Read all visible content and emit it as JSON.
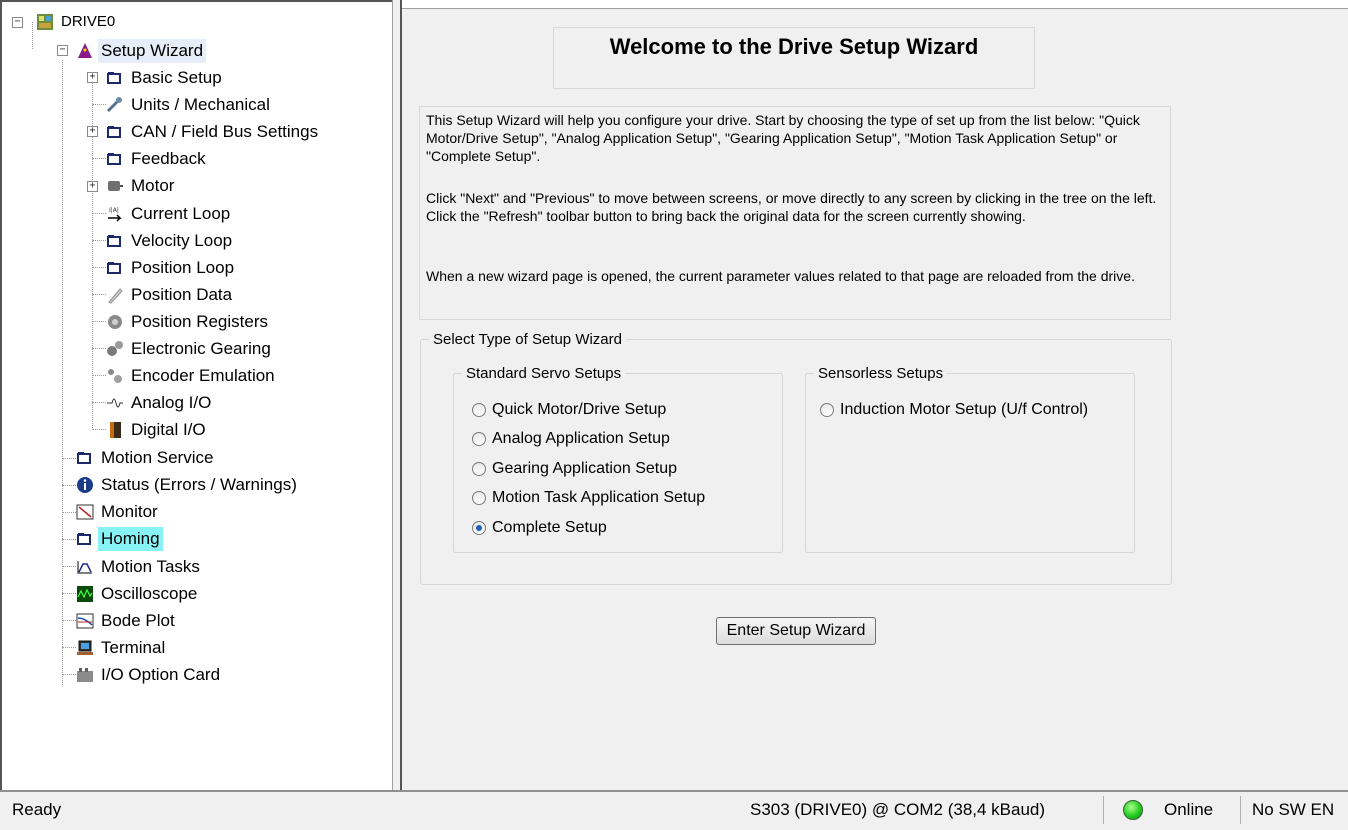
{
  "tree": {
    "root": "DRIVE0",
    "setup_wizard": "Setup Wizard",
    "basic_setup": "Basic Setup",
    "units": "Units / Mechanical",
    "can": "CAN / Field Bus Settings",
    "feedback": "Feedback",
    "motor": "Motor",
    "current_loop": "Current Loop",
    "velocity_loop": "Velocity Loop",
    "position_loop": "Position Loop",
    "position_data": "Position Data",
    "position_registers": "Position Registers",
    "electronic_gearing": "Electronic Gearing",
    "encoder_emulation": "Encoder Emulation",
    "analog_io": "Analog I/O",
    "digital_io": "Digital I/O",
    "motion_service": "Motion Service",
    "status": "Status (Errors / Warnings)",
    "monitor": "Monitor",
    "homing": "Homing",
    "motion_tasks": "Motion Tasks",
    "oscilloscope": "Oscilloscope",
    "bode_plot": "Bode Plot",
    "terminal": "Terminal",
    "io_option_card": "I/O Option Card"
  },
  "main": {
    "title": "Welcome to the Drive Setup Wizard",
    "intro_p1": "This Setup Wizard will help you configure your drive. Start by choosing the type of set up from the list below: \"Quick Motor/Drive Setup\", \"Analog Application Setup\", \"Gearing Application Setup\", \"Motion Task Application Setup\" or \"Complete Setup\".",
    "intro_p2": "Click \"Next\" and \"Previous\" to move between screens, or move directly to any screen by clicking in the tree on the left. Click the \"Refresh\" toolbar button to bring back the original data for the screen currently showing.",
    "intro_p3": "When a new wizard page is opened, the current parameter values related to that page are reloaded from the drive.",
    "select_group": "Select Type of Setup Wizard",
    "standard_group": "Standard Servo Setups",
    "sensorless_group": "Sensorless Setups",
    "standard_options": [
      "Quick Motor/Drive Setup",
      "Analog Application Setup",
      "Gearing Application Setup",
      "Motion Task Application Setup",
      "Complete Setup"
    ],
    "selected_option": "Complete Setup",
    "sensorless_options": [
      "Induction Motor Setup (U/f Control)"
    ],
    "enter_button": "Enter Setup Wizard"
  },
  "status_bar": {
    "state": "Ready",
    "connection": "S303 (DRIVE0) @ COM2 (38,4 kBaud)",
    "online": "Online",
    "sw_enable": "No SW EN",
    "online_color": "#22cc22"
  }
}
